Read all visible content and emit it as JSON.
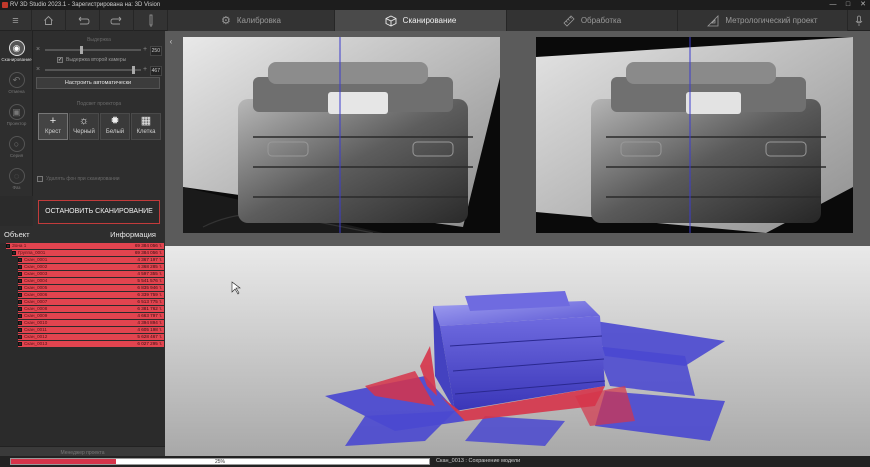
{
  "window": {
    "title": "RV 3D Studio 2023.1 - Зарегистрирована на: 3D Vision",
    "controls": [
      "—",
      "□",
      "✕"
    ]
  },
  "toolbar": {
    "menu_icon": "menu-icon",
    "tabs": [
      {
        "label": "Калибровка",
        "icon": "gear-icon"
      },
      {
        "label": "Сканирование",
        "icon": "cube-icon"
      },
      {
        "label": "Обработка",
        "icon": "ruler-icon"
      },
      {
        "label": "Метрологический проект",
        "icon": "triangle-ruler-icon"
      }
    ]
  },
  "left_nav": {
    "items": [
      {
        "label": "Сканирование",
        "icon": "camera-icon"
      },
      {
        "label": "Отмена",
        "icon": "undo-icon"
      },
      {
        "label": "Проектор",
        "icon": "projector-icon"
      },
      {
        "label": "Серия",
        "icon": "series-icon"
      },
      {
        "label": "Фаз",
        "icon": "phase-icon"
      }
    ]
  },
  "settings": {
    "exposure_label": "Выдержка",
    "exposure_value": "250",
    "second_checkbox_label": "Выдержка второй камеры",
    "second_value": "467",
    "auto_button": "Настроить автоматически",
    "pattern_label": "Подсвет проектора",
    "patterns": [
      {
        "label": "Крест",
        "glyph": "+"
      },
      {
        "label": "Черный",
        "glyph": "☼"
      },
      {
        "label": "Белый",
        "glyph": "✹"
      },
      {
        "label": "Клетка",
        "glyph": "▦"
      }
    ],
    "bg_checkbox_label": "Удалять фон при сканировании",
    "stop_button": "ОСТАНОВИТЬ СКАНИРОВАНИЕ"
  },
  "tree": {
    "col_object": "Объект",
    "col_info": "Информация",
    "rows": [
      {
        "name": "Зона 1",
        "info": "69 384 056 т.",
        "level": 0
      },
      {
        "name": "Группа_0001",
        "info": "69 384 056 т.",
        "level": 1
      },
      {
        "name": "Скан_0001",
        "info": "4 367 197 т.",
        "level": 2
      },
      {
        "name": "Скан_0002",
        "info": "4 368 285 т.",
        "level": 2
      },
      {
        "name": "Скан_0003",
        "info": "4 597 355 т.",
        "level": 2
      },
      {
        "name": "Скан_0004",
        "info": "5 541 576 т.",
        "level": 2
      },
      {
        "name": "Скан_0005",
        "info": "6 835 946 т.",
        "level": 2
      },
      {
        "name": "Скан_0006",
        "info": "6 339 759 т.",
        "level": 2
      },
      {
        "name": "Скан_0007",
        "info": "6 513 775 т.",
        "level": 2
      },
      {
        "name": "Скан_0008",
        "info": "6 381 762 т.",
        "level": 2
      },
      {
        "name": "Скан_0009",
        "info": "4 663 797 т.",
        "level": 2
      },
      {
        "name": "Скан_0010",
        "info": "4 394 894 т.",
        "level": 2
      },
      {
        "name": "Скан_0011",
        "info": "4 605 198 т.",
        "level": 2
      },
      {
        "name": "Скан_0012",
        "info": "5 628 467 т.",
        "level": 2
      },
      {
        "name": "Скан_0013",
        "info": "6 027 295 т.",
        "level": 2
      }
    ],
    "manage_button": "Менеджер проекта"
  },
  "status": {
    "progress": 0.25,
    "progress_text": "25%",
    "message": "Скан_0013 : Сохранение модели"
  },
  "colors": {
    "accent_red": "#e2444f",
    "scan_blue": "#4a48d0",
    "scan_red": "#d6344a"
  }
}
